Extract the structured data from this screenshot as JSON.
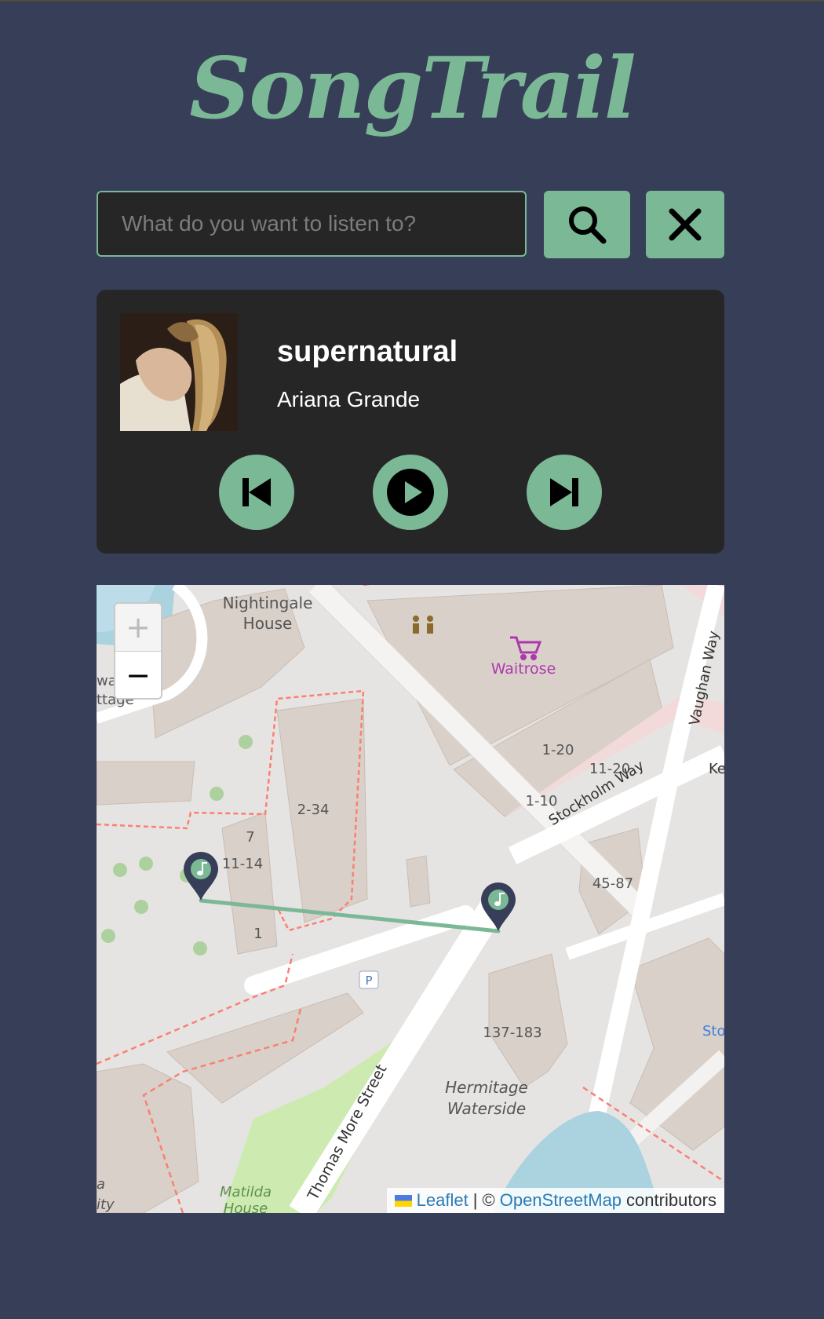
{
  "app": {
    "title": "SongTrail"
  },
  "search": {
    "placeholder": "What do you want to listen to?",
    "value": ""
  },
  "now_playing": {
    "title": "supernatural",
    "artist": "Ariana Grande"
  },
  "map": {
    "labels": {
      "nightingale_house_1": "Nightingale",
      "nightingale_house_2": "House",
      "waitrose": "Waitrose",
      "b_1_20": "1-20",
      "b_11_20": "11-20",
      "b_1_10": "1-10",
      "b_2_34": "2-34",
      "b_7": "7",
      "b_11_14": "11-14",
      "b_1": "1",
      "b_45_87": "45-87",
      "b_137_183": "137-183",
      "stockholm_way": "Stockholm Way",
      "vaughan_way": "Vaughan Way",
      "thomas_more_street": "Thomas More Street",
      "hermitage_1": "Hermitage",
      "hermitage_2": "Waterside",
      "matilda_1": "Matilda",
      "matilda_2": "House",
      "cottage_1": "wa",
      "cottage_2": "ttage",
      "edge_ke": "Ke",
      "edge_sto": "Sto",
      "edge_a": "a",
      "edge_ity": "ity",
      "parking": "P"
    },
    "zoom_in": "+",
    "zoom_out": "−",
    "attribution": {
      "leaflet": "Leaflet",
      "separator": "| ©",
      "osm": "OpenStreetMap",
      "suffix": "contributors"
    },
    "colors": {
      "route": "#7bb896",
      "marker": "#373e58",
      "accent": "#7bb896"
    }
  },
  "icons": {
    "search": "search-icon",
    "clear": "close-icon",
    "previous": "skip-back-icon",
    "play": "play-icon",
    "next": "skip-forward-icon",
    "marker": "music-note-icon"
  }
}
